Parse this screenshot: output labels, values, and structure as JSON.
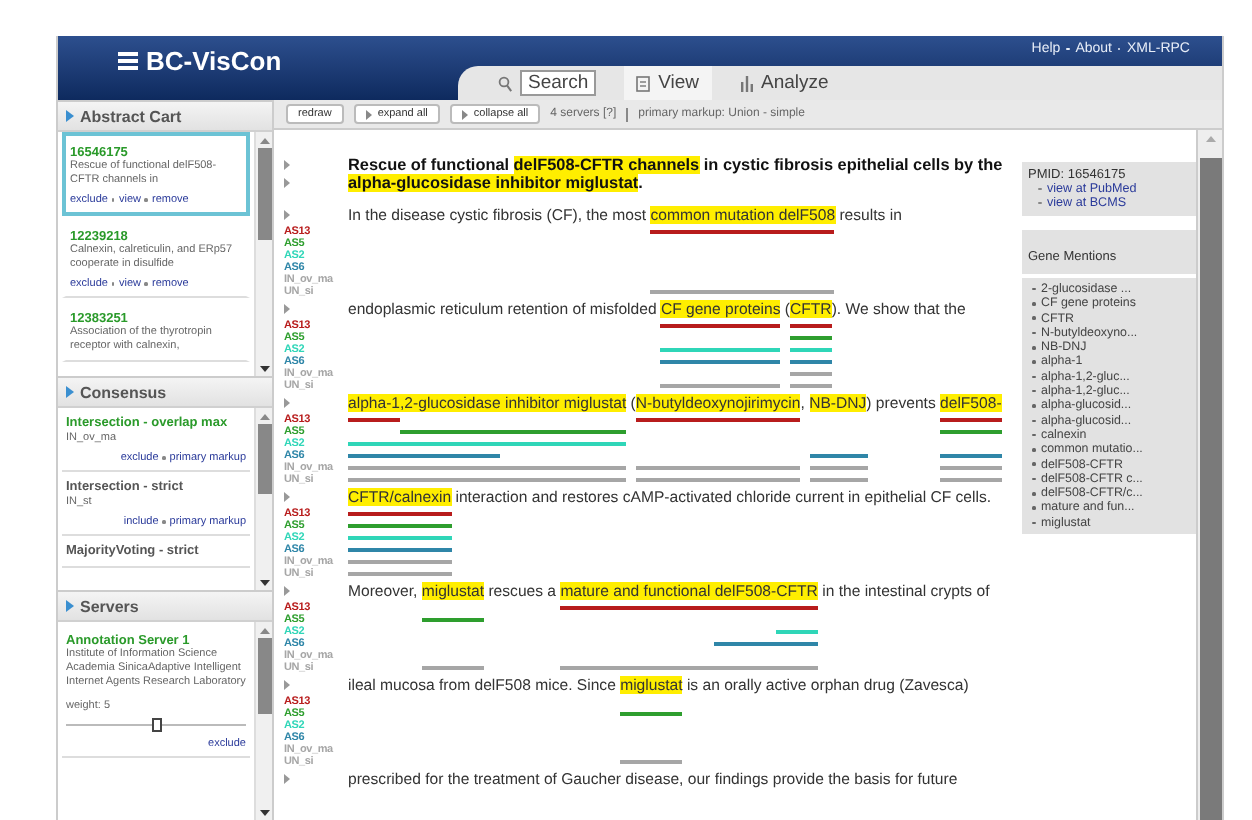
{
  "header": {
    "title": "BC-VisCon",
    "links": [
      "Help",
      "About",
      "XML-RPC"
    ]
  },
  "tabs": [
    {
      "label": "Search",
      "kind": "search",
      "selected": false
    },
    {
      "label": "View",
      "kind": "list",
      "selected": true
    },
    {
      "label": "Analyze",
      "kind": "chart",
      "selected": false
    }
  ],
  "sidebar": {
    "sections": [
      {
        "title": "Abstract Cart",
        "kind": "cart",
        "items": [
          {
            "id": "16546175",
            "description": "Rescue of functional delF508-CFTR channels in",
            "links": [
              "exclude",
              "view",
              "remove"
            ],
            "selected": true
          },
          {
            "id": "12239218",
            "description": "Calnexin, calreticulin, and ERp57 cooperate in disulfide",
            "links": [
              "exclude",
              "view",
              "remove"
            ],
            "selected": false
          },
          {
            "id": "12383251",
            "description": "Association of the thyrotropin receptor with calnexin,",
            "selected": false
          }
        ]
      },
      {
        "title": "Consensus",
        "kind": "consensus",
        "items": [
          {
            "name": "Intersection - overlap max",
            "code": "IN_ov_ma",
            "links": [
              "exclude",
              "primary markup"
            ]
          },
          {
            "name": "Intersection - strict",
            "code": "IN_st",
            "links": [
              "include",
              "primary markup"
            ]
          },
          {
            "name": "MajorityVoting - strict"
          }
        ]
      },
      {
        "title": "Servers",
        "kind": "servers",
        "items": [
          {
            "name": "Annotation Server 1",
            "description": "Institute of Information Science Academia SinicaAdaptive Intelligent Internet Agents Research Laboratory",
            "weight": "weight: 5",
            "level": 0.5,
            "links": [
              "exclude"
            ]
          }
        ]
      }
    ]
  },
  "toolbar": {
    "buttons": [
      {
        "label": "redraw",
        "kind": "plain"
      },
      {
        "label": "expand all",
        "kind": "arrow"
      },
      {
        "label": "collapse all",
        "kind": "arrow"
      }
    ],
    "servers": "4 servers [?]",
    "markup": "primary markup: Union - simple"
  },
  "abstract": {
    "title": [
      {
        "text": "Rescue of functional ",
        "highlight": false
      },
      {
        "text": "delF508-CFTR channels",
        "highlight": true
      },
      {
        "text": " in cystic fibrosis epithelial cells by the ",
        "highlight": false
      },
      {
        "text": "alpha-glucosidase inhibitor miglustat",
        "highlight": true
      },
      {
        "text": ".",
        "highlight": false
      }
    ],
    "lines": [
      {
        "segments": [
          {
            "text": "In the disease cystic fibrosis (CF), the most ",
            "highlight": false
          },
          {
            "text": "common mutation delF508",
            "highlight": true
          },
          {
            "text": " results in",
            "highlight": false
          }
        ],
        "tracks": [
          {
            "label": "AS13",
            "color": "#b81c1c",
            "marked": [
              false,
              true,
              false
            ]
          },
          {
            "label": "AS5",
            "color": "#2e9e2e",
            "marked": [
              false,
              false,
              false
            ]
          },
          {
            "label": "AS2",
            "color": "#2fd6b8",
            "marked": [
              false,
              false,
              false
            ]
          },
          {
            "label": "AS6",
            "color": "#2f86a8",
            "marked": [
              false,
              false,
              false
            ]
          },
          {
            "label": "IN_ov_ma",
            "color": "#a6a6a6",
            "marked": [
              false,
              false,
              false
            ]
          },
          {
            "label": "UN_si",
            "color": "#a6a6a6",
            "marked": [
              false,
              true,
              false
            ]
          }
        ]
      },
      {
        "segments": [
          {
            "text": "endoplasmic reticulum retention of misfolded ",
            "highlight": false
          },
          {
            "text": "CF gene proteins",
            "highlight": true
          },
          {
            "text": " (",
            "highlight": false
          },
          {
            "text": "CFTR",
            "highlight": true
          },
          {
            "text": "). We show that the",
            "highlight": false
          }
        ],
        "tracks": [
          {
            "label": "AS13",
            "color": "#b81c1c",
            "marked": [
              false,
              true,
              false,
              true,
              false
            ]
          },
          {
            "label": "AS5",
            "color": "#2e9e2e",
            "marked": [
              false,
              false,
              false,
              true,
              false
            ]
          },
          {
            "label": "AS2",
            "color": "#2fd6b8",
            "marked": [
              false,
              true,
              false,
              true,
              false
            ]
          },
          {
            "label": "AS6",
            "color": "#2f86a8",
            "marked": [
              false,
              true,
              false,
              true,
              false
            ]
          },
          {
            "label": "IN_ov_ma",
            "color": "#a6a6a6",
            "marked": [
              false,
              false,
              false,
              true,
              false
            ]
          },
          {
            "label": "UN_si",
            "color": "#a6a6a6",
            "marked": [
              false,
              true,
              false,
              true,
              false
            ]
          }
        ]
      },
      {
        "segments": [
          {
            "text": "alpha-1",
            "highlight": true
          },
          {
            "text": ",2-glucosidase",
            "highlight": true
          },
          {
            "text": " inhibitor miglustat",
            "highlight": true
          },
          {
            "text": " (",
            "highlight": false
          },
          {
            "text": "N-butyldeoxynojirimycin",
            "highlight": true
          },
          {
            "text": ", ",
            "highlight": false
          },
          {
            "text": "NB-DNJ",
            "highlight": true
          },
          {
            "text": ") prevents ",
            "highlight": false
          },
          {
            "text": "delF508-",
            "highlight": true
          }
        ],
        "tracks": [
          {
            "label": "AS13",
            "color": "#b81c1c",
            "marked": [
              true,
              false,
              false,
              false,
              true,
              false,
              false,
              false,
              true
            ]
          },
          {
            "label": "AS5",
            "color": "#2e9e2e",
            "marked": [
              false,
              true,
              true,
              false,
              false,
              false,
              false,
              false,
              true
            ]
          },
          {
            "label": "AS2",
            "color": "#2fd6b8",
            "marked": [
              true,
              true,
              true,
              false,
              false,
              false,
              false,
              false,
              false
            ]
          },
          {
            "label": "AS6",
            "color": "#2f86a8",
            "marked": [
              true,
              true,
              false,
              false,
              false,
              false,
              true,
              false,
              true
            ]
          },
          {
            "label": "IN_ov_ma",
            "color": "#a6a6a6",
            "marked": [
              true,
              true,
              true,
              false,
              true,
              false,
              true,
              false,
              true
            ]
          },
          {
            "label": "UN_si",
            "color": "#a6a6a6",
            "marked": [
              true,
              true,
              true,
              false,
              true,
              false,
              true,
              false,
              true
            ]
          }
        ]
      },
      {
        "segments": [
          {
            "text": "CFTR/calnexin",
            "highlight": true
          },
          {
            "text": " interaction and restores cAMP-activated chloride current in epithelial CF cells.",
            "highlight": false
          }
        ],
        "tracks": [
          {
            "label": "AS13",
            "color": "#b81c1c",
            "marked": [
              true,
              false
            ]
          },
          {
            "label": "AS5",
            "color": "#2e9e2e",
            "marked": [
              true,
              false
            ]
          },
          {
            "label": "AS2",
            "color": "#2fd6b8",
            "marked": [
              true,
              false
            ]
          },
          {
            "label": "AS6",
            "color": "#2f86a8",
            "marked": [
              true,
              false
            ]
          },
          {
            "label": "IN_ov_ma",
            "color": "#a6a6a6",
            "marked": [
              true,
              false
            ]
          },
          {
            "label": "UN_si",
            "color": "#a6a6a6",
            "marked": [
              true,
              false
            ]
          }
        ]
      },
      {
        "segments": [
          {
            "text": "Moreover, ",
            "highlight": false
          },
          {
            "text": "miglustat",
            "highlight": true
          },
          {
            "text": " rescues a ",
            "highlight": false
          },
          {
            "text": "mature and functional ",
            "highlight": true
          },
          {
            "text": "delF508-",
            "highlight": true
          },
          {
            "text": "CFTR",
            "highlight": true
          },
          {
            "text": " in the intestinal crypts of",
            "highlight": false
          }
        ],
        "tracks": [
          {
            "label": "AS13",
            "color": "#b81c1c",
            "marked": [
              false,
              false,
              false,
              true,
              true,
              true,
              false
            ]
          },
          {
            "label": "AS5",
            "color": "#2e9e2e",
            "marked": [
              false,
              true,
              false,
              false,
              false,
              false,
              false
            ]
          },
          {
            "label": "AS2",
            "color": "#2fd6b8",
            "marked": [
              false,
              false,
              false,
              false,
              false,
              true,
              false
            ]
          },
          {
            "label": "AS6",
            "color": "#2f86a8",
            "marked": [
              false,
              false,
              false,
              false,
              true,
              true,
              false
            ]
          },
          {
            "label": "IN_ov_ma",
            "color": "#a6a6a6",
            "marked": [
              false,
              false,
              false,
              false,
              false,
              false,
              false
            ]
          },
          {
            "label": "UN_si",
            "color": "#a6a6a6",
            "marked": [
              false,
              true,
              false,
              true,
              true,
              true,
              false
            ]
          }
        ]
      },
      {
        "segments": [
          {
            "text": "ileal mucosa from delF508 mice. Since ",
            "highlight": false
          },
          {
            "text": "miglustat",
            "highlight": true
          },
          {
            "text": " is an orally active orphan drug (Zavesca)",
            "highlight": false
          }
        ],
        "tracks": [
          {
            "label": "AS13",
            "color": "#b81c1c",
            "marked": [
              false,
              false,
              false
            ]
          },
          {
            "label": "AS5",
            "color": "#2e9e2e",
            "marked": [
              false,
              true,
              false
            ]
          },
          {
            "label": "AS2",
            "color": "#2fd6b8",
            "marked": [
              false,
              false,
              false
            ]
          },
          {
            "label": "AS6",
            "color": "#2f86a8",
            "marked": [
              false,
              false,
              false
            ]
          },
          {
            "label": "IN_ov_ma",
            "color": "#a6a6a6",
            "marked": [
              false,
              false,
              false
            ]
          },
          {
            "label": "UN_si",
            "color": "#a6a6a6",
            "marked": [
              false,
              true,
              false
            ]
          }
        ]
      },
      {
        "segments": [
          {
            "text": "prescribed for the treatment of Gaucher disease, our findings provide the basis for future",
            "highlight": false
          }
        ]
      }
    ]
  },
  "details": {
    "pmid": "PMID: 16546175",
    "links": [
      "view at PubMed",
      "view at BCMS"
    ],
    "genes_title": "Gene Mentions",
    "genes": [
      "2-glucosidase ...",
      "CF gene proteins",
      "CFTR",
      "N-butyldeoxyno...",
      "NB-DNJ",
      "alpha-1",
      "alpha-1,2-gluc...",
      "alpha-1,2-gluc...",
      "alpha-glucosid...",
      "alpha-glucosid...",
      "calnexin",
      "common mutatio...",
      "delF508-CFTR",
      "delF508-CFTR c...",
      "delF508-CFTR/c...",
      "mature and fun...",
      "miglustat"
    ]
  }
}
